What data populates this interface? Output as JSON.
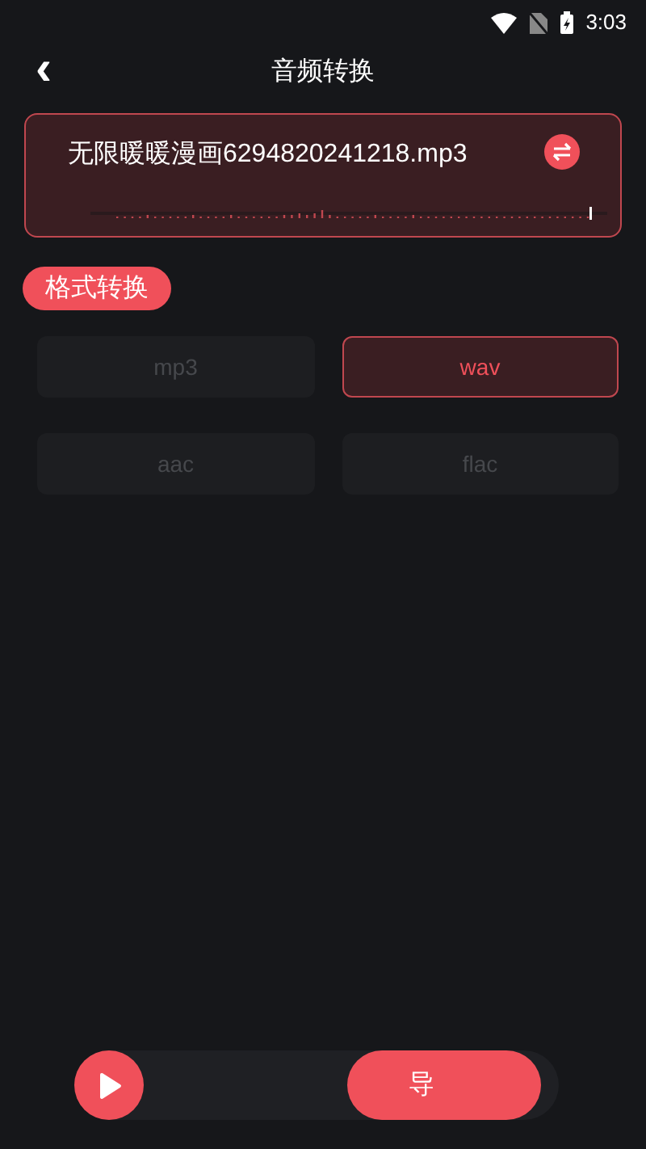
{
  "status_bar": {
    "time": "3:03"
  },
  "header": {
    "back": "‹",
    "title": "音频转换"
  },
  "file": {
    "name": "无限暖暖漫画6294820241218.mp3"
  },
  "section": {
    "label": "格式转换"
  },
  "formats": [
    {
      "label": "mp3",
      "selected": false
    },
    {
      "label": "wav",
      "selected": true
    },
    {
      "label": "aac",
      "selected": false
    },
    {
      "label": "flac",
      "selected": false
    }
  ],
  "bottom": {
    "export_label": "导"
  }
}
